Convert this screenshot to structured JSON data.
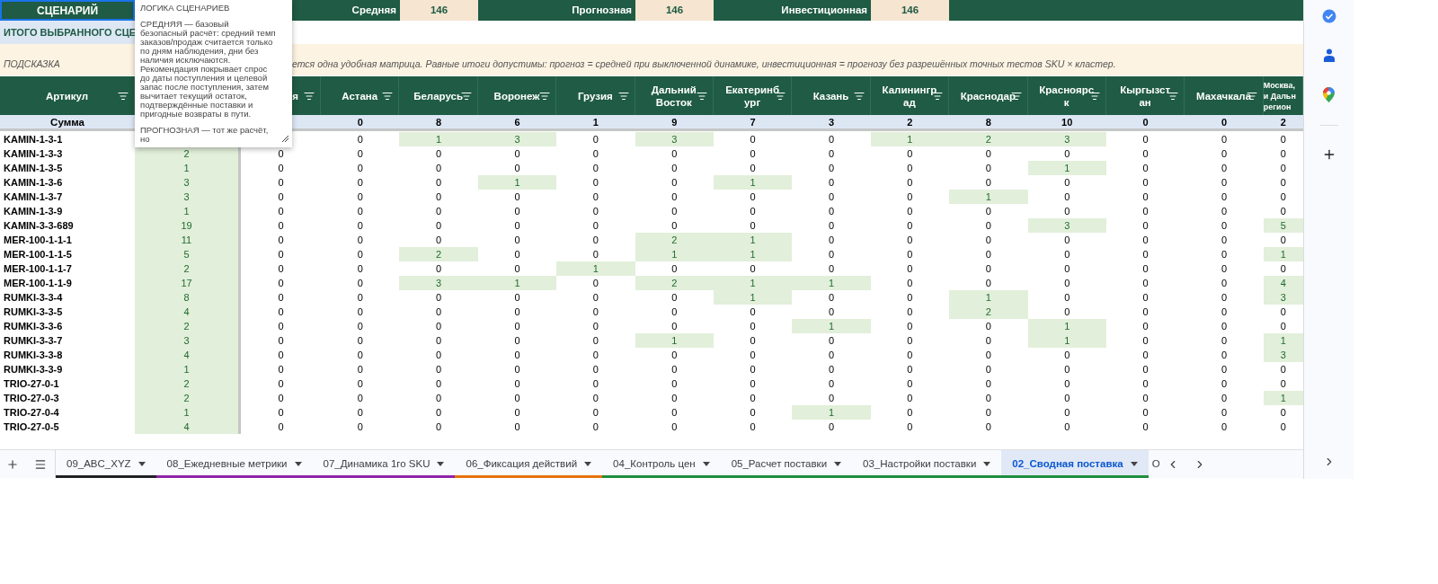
{
  "top_bar": {
    "title": "СЦЕНАРИЙ",
    "scenarios": [
      {
        "label": "Средняя",
        "value": "146"
      },
      {
        "label": "Прогнозная",
        "value": "146"
      },
      {
        "label": "Инвестиционная",
        "value": "146"
      }
    ]
  },
  "summary_label": "ИТОГО ВЫБРАННОГО СЦЕ",
  "hint": {
    "label": "ПОДСКАЗКА",
    "text": "ется одна удобная матрица. Равные итоги допустимы: прогноз = средней при выключенной динамике, инвестиционная = прогнозу без разрешённых точных тестов SKU × кластер."
  },
  "tooltip": {
    "title": "ЛОГИКА СЦЕНАРИЕВ",
    "paragraphs": [
      "СРЕДНЯЯ — базовый безопасный расчёт: средний темп заказов/продаж считается только по дням наблюдения, дни без наличия исключаются. Рекомендация покрывает спрос до даты поступления и целевой запас после поступления, затем вычитает текущий остаток, подтверждённые поставки и пригодные возвраты в пути.",
      "ПРОГНОЗНАЯ — тот же расчёт, но"
    ]
  },
  "table": {
    "sku_header": "Артикул",
    "columns": [
      {
        "label": "я",
        "filter": true
      },
      {
        "label": "Астана",
        "filter": true
      },
      {
        "label": "Беларусь",
        "filter": true
      },
      {
        "label": "Воронеж",
        "filter": true
      },
      {
        "label": "Грузия",
        "filter": true
      },
      {
        "label": "Дальний Восток",
        "filter": true
      },
      {
        "label": "Екатеринбург",
        "filter": true
      },
      {
        "label": "Казань",
        "filter": true
      },
      {
        "label": "Калининград",
        "filter": true
      },
      {
        "label": "Краснодар",
        "filter": true
      },
      {
        "label": "Красноярск",
        "filter": true
      },
      {
        "label": "Кыргызстан",
        "filter": true
      },
      {
        "label": "Махачкала",
        "filter": true
      },
      {
        "label": "Москва,\nи Дальн\nрегион",
        "filter": false
      }
    ],
    "sum_row": {
      "label": "Сумма",
      "values": [
        "0",
        "8",
        "6",
        "1",
        "9",
        "7",
        "3",
        "2",
        "8",
        "10",
        "0",
        "0",
        "2"
      ]
    },
    "rows": [
      {
        "sku": "KAMIN-1-3-1",
        "cells": [
          {},
          {
            "value": "0",
            "highlighted": false
          },
          {
            "value": "1",
            "highlighted": true
          },
          {
            "value": "3",
            "highlighted": true
          },
          {
            "value": "0",
            "highlighted": false
          },
          {
            "value": "3",
            "highlighted": true
          },
          {
            "value": "0",
            "highlighted": false
          },
          {
            "value": "0",
            "highlighted": false
          },
          {
            "value": "1",
            "highlighted": true
          },
          {
            "value": "2",
            "highlighted": true
          },
          {
            "value": "3",
            "highlighted": true
          },
          {
            "value": "0",
            "highlighted": false
          },
          {
            "value": "0",
            "highlighted": false
          },
          {
            "value": "0",
            "highlighted": false
          }
        ]
      },
      {
        "sku": "KAMIN-1-3-3",
        "total": "2",
        "cells": [
          {
            "value": "0",
            "highlighted": false
          },
          {
            "value": "0",
            "highlighted": false
          },
          {
            "value": "0",
            "highlighted": false
          },
          {
            "value": "0",
            "highlighted": false
          },
          {
            "value": "0",
            "highlighted": false
          },
          {
            "value": "0",
            "highlighted": false
          },
          {
            "value": "0",
            "highlighted": false
          },
          {
            "value": "0",
            "highlighted": false
          },
          {
            "value": "0",
            "highlighted": false
          },
          {
            "value": "0",
            "highlighted": false
          },
          {
            "value": "0",
            "highlighted": false
          },
          {
            "value": "0",
            "highlighted": false
          },
          {
            "value": "0",
            "highlighted": false
          },
          {
            "value": "0",
            "highlighted": false
          }
        ]
      },
      {
        "sku": "KAMIN-1-3-5",
        "total": "1",
        "cells": [
          {
            "value": "0",
            "highlighted": false
          },
          {
            "value": "0",
            "highlighted": false
          },
          {
            "value": "0",
            "highlighted": false
          },
          {
            "value": "0",
            "highlighted": false
          },
          {
            "value": "0",
            "highlighted": false
          },
          {
            "value": "0",
            "highlighted": false
          },
          {
            "value": "0",
            "highlighted": false
          },
          {
            "value": "0",
            "highlighted": false
          },
          {
            "value": "0",
            "highlighted": false
          },
          {
            "value": "0",
            "highlighted": false
          },
          {
            "value": "1",
            "highlighted": true
          },
          {
            "value": "0",
            "highlighted": false
          },
          {
            "value": "0",
            "highlighted": false
          },
          {
            "value": "0",
            "highlighted": false
          }
        ]
      },
      {
        "sku": "KAMIN-1-3-6",
        "total": "3",
        "cells": [
          {
            "value": "0",
            "highlighted": false
          },
          {
            "value": "0",
            "highlighted": false
          },
          {
            "value": "0",
            "highlighted": false
          },
          {
            "value": "1",
            "highlighted": true
          },
          {
            "value": "0",
            "highlighted": false
          },
          {
            "value": "0",
            "highlighted": false
          },
          {
            "value": "1",
            "highlighted": true
          },
          {
            "value": "0",
            "highlighted": false
          },
          {
            "value": "0",
            "highlighted": false
          },
          {
            "value": "0",
            "highlighted": false
          },
          {
            "value": "0",
            "highlighted": false
          },
          {
            "value": "0",
            "highlighted": false
          },
          {
            "value": "0",
            "highlighted": false
          },
          {
            "value": "0",
            "highlighted": false
          }
        ]
      },
      {
        "sku": "KAMIN-1-3-7",
        "total": "3",
        "cells": [
          {
            "value": "0",
            "highlighted": false
          },
          {
            "value": "0",
            "highlighted": false
          },
          {
            "value": "0",
            "highlighted": false
          },
          {
            "value": "0",
            "highlighted": false
          },
          {
            "value": "0",
            "highlighted": false
          },
          {
            "value": "0",
            "highlighted": false
          },
          {
            "value": "0",
            "highlighted": false
          },
          {
            "value": "0",
            "highlighted": false
          },
          {
            "value": "0",
            "highlighted": false
          },
          {
            "value": "1",
            "highlighted": true
          },
          {
            "value": "0",
            "highlighted": false
          },
          {
            "value": "0",
            "highlighted": false
          },
          {
            "value": "0",
            "highlighted": false
          },
          {
            "value": "0",
            "highlighted": false
          }
        ]
      },
      {
        "sku": "KAMIN-1-3-9",
        "total": "1",
        "cells": [
          {
            "value": "0",
            "highlighted": false
          },
          {
            "value": "0",
            "highlighted": false
          },
          {
            "value": "0",
            "highlighted": false
          },
          {
            "value": "0",
            "highlighted": false
          },
          {
            "value": "0",
            "highlighted": false
          },
          {
            "value": "0",
            "highlighted": false
          },
          {
            "value": "0",
            "highlighted": false
          },
          {
            "value": "0",
            "highlighted": false
          },
          {
            "value": "0",
            "highlighted": false
          },
          {
            "value": "0",
            "highlighted": false
          },
          {
            "value": "0",
            "highlighted": false
          },
          {
            "value": "0",
            "highlighted": false
          },
          {
            "value": "0",
            "highlighted": false
          },
          {
            "value": "0",
            "highlighted": false
          }
        ]
      },
      {
        "sku": "KAMIN-3-3-689",
        "total": "19",
        "cells": [
          {
            "value": "0",
            "highlighted": false
          },
          {
            "value": "0",
            "highlighted": false
          },
          {
            "value": "0",
            "highlighted": false
          },
          {
            "value": "0",
            "highlighted": false
          },
          {
            "value": "0",
            "highlighted": false
          },
          {
            "value": "0",
            "highlighted": false
          },
          {
            "value": "0",
            "highlighted": false
          },
          {
            "value": "0",
            "highlighted": false
          },
          {
            "value": "0",
            "highlighted": false
          },
          {
            "value": "0",
            "highlighted": false
          },
          {
            "value": "3",
            "highlighted": true
          },
          {
            "value": "0",
            "highlighted": false
          },
          {
            "value": "0",
            "highlighted": false
          },
          {
            "value": "5",
            "highlighted": true
          }
        ]
      },
      {
        "sku": "MER-100-1-1-1",
        "total": "11",
        "cells": [
          {
            "value": "0",
            "highlighted": false
          },
          {
            "value": "0",
            "highlighted": false
          },
          {
            "value": "0",
            "highlighted": false
          },
          {
            "value": "0",
            "highlighted": false
          },
          {
            "value": "0",
            "highlighted": false
          },
          {
            "value": "2",
            "highlighted": true
          },
          {
            "value": "1",
            "highlighted": true
          },
          {
            "value": "0",
            "highlighted": false
          },
          {
            "value": "0",
            "highlighted": false
          },
          {
            "value": "0",
            "highlighted": false
          },
          {
            "value": "0",
            "highlighted": false
          },
          {
            "value": "0",
            "highlighted": false
          },
          {
            "value": "0",
            "highlighted": false
          },
          {
            "value": "0",
            "highlighted": false
          }
        ]
      },
      {
        "sku": "MER-100-1-1-5",
        "total": "5",
        "cells": [
          {
            "value": "0",
            "highlighted": false
          },
          {
            "value": "0",
            "highlighted": false
          },
          {
            "value": "2",
            "highlighted": true
          },
          {
            "value": "0",
            "highlighted": false
          },
          {
            "value": "0",
            "highlighted": false
          },
          {
            "value": "1",
            "highlighted": true
          },
          {
            "value": "1",
            "highlighted": true
          },
          {
            "value": "0",
            "highlighted": false
          },
          {
            "value": "0",
            "highlighted": false
          },
          {
            "value": "0",
            "highlighted": false
          },
          {
            "value": "0",
            "highlighted": false
          },
          {
            "value": "0",
            "highlighted": false
          },
          {
            "value": "0",
            "highlighted": false
          },
          {
            "value": "1",
            "highlighted": true
          }
        ]
      },
      {
        "sku": "MER-100-1-1-7",
        "total": "2",
        "cells": [
          {
            "value": "0",
            "highlighted": false
          },
          {
            "value": "0",
            "highlighted": false
          },
          {
            "value": "0",
            "highlighted": false
          },
          {
            "value": "0",
            "highlighted": false
          },
          {
            "value": "1",
            "highlighted": true
          },
          {
            "value": "0",
            "highlighted": false
          },
          {
            "value": "0",
            "highlighted": false
          },
          {
            "value": "0",
            "highlighted": false
          },
          {
            "value": "0",
            "highlighted": false
          },
          {
            "value": "0",
            "highlighted": false
          },
          {
            "value": "0",
            "highlighted": false
          },
          {
            "value": "0",
            "highlighted": false
          },
          {
            "value": "0",
            "highlighted": false
          },
          {
            "value": "0",
            "highlighted": false
          }
        ]
      },
      {
        "sku": "MER-100-1-1-9",
        "total": "17",
        "cells": [
          {
            "value": "0",
            "highlighted": false
          },
          {
            "value": "0",
            "highlighted": false
          },
          {
            "value": "3",
            "highlighted": true
          },
          {
            "value": "1",
            "highlighted": true
          },
          {
            "value": "0",
            "highlighted": false
          },
          {
            "value": "2",
            "highlighted": true
          },
          {
            "value": "1",
            "highlighted": true
          },
          {
            "value": "1",
            "highlighted": true
          },
          {
            "value": "0",
            "highlighted": false
          },
          {
            "value": "0",
            "highlighted": false
          },
          {
            "value": "0",
            "highlighted": false
          },
          {
            "value": "0",
            "highlighted": false
          },
          {
            "value": "0",
            "highlighted": false
          },
          {
            "value": "4",
            "highlighted": true
          }
        ]
      },
      {
        "sku": "RUMKI-3-3-4",
        "total": "8",
        "cells": [
          {
            "value": "0",
            "highlighted": false
          },
          {
            "value": "0",
            "highlighted": false
          },
          {
            "value": "0",
            "highlighted": false
          },
          {
            "value": "0",
            "highlighted": false
          },
          {
            "value": "0",
            "highlighted": false
          },
          {
            "value": "0",
            "highlighted": false
          },
          {
            "value": "1",
            "highlighted": true
          },
          {
            "value": "0",
            "highlighted": false
          },
          {
            "value": "0",
            "highlighted": false
          },
          {
            "value": "1",
            "highlighted": true
          },
          {
            "value": "0",
            "highlighted": false
          },
          {
            "value": "0",
            "highlighted": false
          },
          {
            "value": "0",
            "highlighted": false
          },
          {
            "value": "3",
            "highlighted": true
          }
        ]
      },
      {
        "sku": "RUMKI-3-3-5",
        "total": "4",
        "cells": [
          {
            "value": "0",
            "highlighted": false
          },
          {
            "value": "0",
            "highlighted": false
          },
          {
            "value": "0",
            "highlighted": false
          },
          {
            "value": "0",
            "highlighted": false
          },
          {
            "value": "0",
            "highlighted": false
          },
          {
            "value": "0",
            "highlighted": false
          },
          {
            "value": "0",
            "highlighted": false
          },
          {
            "value": "0",
            "highlighted": false
          },
          {
            "value": "0",
            "highlighted": false
          },
          {
            "value": "2",
            "highlighted": true
          },
          {
            "value": "0",
            "highlighted": false
          },
          {
            "value": "0",
            "highlighted": false
          },
          {
            "value": "0",
            "highlighted": false
          },
          {
            "value": "0",
            "highlighted": false
          }
        ]
      },
      {
        "sku": "RUMKI-3-3-6",
        "total": "2",
        "cells": [
          {
            "value": "0",
            "highlighted": false
          },
          {
            "value": "0",
            "highlighted": false
          },
          {
            "value": "0",
            "highlighted": false
          },
          {
            "value": "0",
            "highlighted": false
          },
          {
            "value": "0",
            "highlighted": false
          },
          {
            "value": "0",
            "highlighted": false
          },
          {
            "value": "0",
            "highlighted": false
          },
          {
            "value": "1",
            "highlighted": true
          },
          {
            "value": "0",
            "highlighted": false
          },
          {
            "value": "0",
            "highlighted": false
          },
          {
            "value": "1",
            "highlighted": true
          },
          {
            "value": "0",
            "highlighted": false
          },
          {
            "value": "0",
            "highlighted": false
          },
          {
            "value": "0",
            "highlighted": false
          }
        ]
      },
      {
        "sku": "RUMKI-3-3-7",
        "total": "3",
        "cells": [
          {
            "value": "0",
            "highlighted": false
          },
          {
            "value": "0",
            "highlighted": false
          },
          {
            "value": "0",
            "highlighted": false
          },
          {
            "value": "0",
            "highlighted": false
          },
          {
            "value": "0",
            "highlighted": false
          },
          {
            "value": "1",
            "highlighted": true
          },
          {
            "value": "0",
            "highlighted": false
          },
          {
            "value": "0",
            "highlighted": false
          },
          {
            "value": "0",
            "highlighted": false
          },
          {
            "value": "0",
            "highlighted": false
          },
          {
            "value": "1",
            "highlighted": true
          },
          {
            "value": "0",
            "highlighted": false
          },
          {
            "value": "0",
            "highlighted": false
          },
          {
            "value": "1",
            "highlighted": true
          }
        ]
      },
      {
        "sku": "RUMKI-3-3-8",
        "total": "4",
        "cells": [
          {
            "value": "0",
            "highlighted": false
          },
          {
            "value": "0",
            "highlighted": false
          },
          {
            "value": "0",
            "highlighted": false
          },
          {
            "value": "0",
            "highlighted": false
          },
          {
            "value": "0",
            "highlighted": false
          },
          {
            "value": "0",
            "highlighted": false
          },
          {
            "value": "0",
            "highlighted": false
          },
          {
            "value": "0",
            "highlighted": false
          },
          {
            "value": "0",
            "highlighted": false
          },
          {
            "value": "0",
            "highlighted": false
          },
          {
            "value": "0",
            "highlighted": false
          },
          {
            "value": "0",
            "highlighted": false
          },
          {
            "value": "0",
            "highlighted": false
          },
          {
            "value": "3",
            "highlighted": true
          }
        ]
      },
      {
        "sku": "RUMKI-3-3-9",
        "total": "1",
        "cells": [
          {
            "value": "0",
            "highlighted": false
          },
          {
            "value": "0",
            "highlighted": false
          },
          {
            "value": "0",
            "highlighted": false
          },
          {
            "value": "0",
            "highlighted": false
          },
          {
            "value": "0",
            "highlighted": false
          },
          {
            "value": "0",
            "highlighted": false
          },
          {
            "value": "0",
            "highlighted": false
          },
          {
            "value": "0",
            "highlighted": false
          },
          {
            "value": "0",
            "highlighted": false
          },
          {
            "value": "0",
            "highlighted": false
          },
          {
            "value": "0",
            "highlighted": false
          },
          {
            "value": "0",
            "highlighted": false
          },
          {
            "value": "0",
            "highlighted": false
          },
          {
            "value": "0",
            "highlighted": false
          }
        ]
      },
      {
        "sku": "TRIO-27-0-1",
        "total": "2",
        "cells": [
          {
            "value": "0",
            "highlighted": false
          },
          {
            "value": "0",
            "highlighted": false
          },
          {
            "value": "0",
            "highlighted": false
          },
          {
            "value": "0",
            "highlighted": false
          },
          {
            "value": "0",
            "highlighted": false
          },
          {
            "value": "0",
            "highlighted": false
          },
          {
            "value": "0",
            "highlighted": false
          },
          {
            "value": "0",
            "highlighted": false
          },
          {
            "value": "0",
            "highlighted": false
          },
          {
            "value": "0",
            "highlighted": false
          },
          {
            "value": "0",
            "highlighted": false
          },
          {
            "value": "0",
            "highlighted": false
          },
          {
            "value": "0",
            "highlighted": false
          },
          {
            "value": "0",
            "highlighted": false
          }
        ]
      },
      {
        "sku": "TRIO-27-0-3",
        "total": "2",
        "cells": [
          {
            "value": "0",
            "highlighted": false
          },
          {
            "value": "0",
            "highlighted": false
          },
          {
            "value": "0",
            "highlighted": false
          },
          {
            "value": "0",
            "highlighted": false
          },
          {
            "value": "0",
            "highlighted": false
          },
          {
            "value": "0",
            "highlighted": false
          },
          {
            "value": "0",
            "highlighted": false
          },
          {
            "value": "0",
            "highlighted": false
          },
          {
            "value": "0",
            "highlighted": false
          },
          {
            "value": "0",
            "highlighted": false
          },
          {
            "value": "0",
            "highlighted": false
          },
          {
            "value": "0",
            "highlighted": false
          },
          {
            "value": "0",
            "highlighted": false
          },
          {
            "value": "1",
            "highlighted": true
          }
        ]
      },
      {
        "sku": "TRIO-27-0-4",
        "total": "1",
        "cells": [
          {
            "value": "0",
            "highlighted": false
          },
          {
            "value": "0",
            "highlighted": false
          },
          {
            "value": "0",
            "highlighted": false
          },
          {
            "value": "0",
            "highlighted": false
          },
          {
            "value": "0",
            "highlighted": false
          },
          {
            "value": "0",
            "highlighted": false
          },
          {
            "value": "0",
            "highlighted": false
          },
          {
            "value": "1",
            "highlighted": true
          },
          {
            "value": "0",
            "highlighted": false
          },
          {
            "value": "0",
            "highlighted": false
          },
          {
            "value": "0",
            "highlighted": false
          },
          {
            "value": "0",
            "highlighted": false
          },
          {
            "value": "0",
            "highlighted": false
          },
          {
            "value": "0",
            "highlighted": false
          }
        ]
      },
      {
        "sku": "TRIO-27-0-5",
        "total": "4",
        "cells": [
          {
            "value": "0",
            "highlighted": false
          },
          {
            "value": "0",
            "highlighted": false
          },
          {
            "value": "0",
            "highlighted": false
          },
          {
            "value": "0",
            "highlighted": false
          },
          {
            "value": "0",
            "highlighted": false
          },
          {
            "value": "0",
            "highlighted": false
          },
          {
            "value": "0",
            "highlighted": false
          },
          {
            "value": "0",
            "highlighted": false
          },
          {
            "value": "0",
            "highlighted": false
          },
          {
            "value": "0",
            "highlighted": false
          },
          {
            "value": "0",
            "highlighted": false
          },
          {
            "value": "0",
            "highlighted": false
          },
          {
            "value": "0",
            "highlighted": false
          },
          {
            "value": "0",
            "highlighted": false
          }
        ]
      }
    ]
  },
  "tabs": [
    {
      "label": "09_ABC_XYZ",
      "color": "#202124",
      "selected": false
    },
    {
      "label": "08_Ежедневные метрики",
      "color": "#8e24aa",
      "selected": false
    },
    {
      "label": "07_Динамика 1го SKU",
      "color": "#8e24aa",
      "selected": false
    },
    {
      "label": "06_Фиксация действий",
      "color": "#e8710a",
      "selected": false
    },
    {
      "label": "04_Контроль цен",
      "color": "#1e8e3e",
      "selected": false
    },
    {
      "label": "05_Расчет поставки",
      "color": "#1e8e3e",
      "selected": false
    },
    {
      "label": "03_Настройки поставки",
      "color": "#1e8e3e",
      "selected": false
    },
    {
      "label": "02_Сводная поставка",
      "color": "#1e8e3e",
      "selected": true
    }
  ],
  "cut_tab": "О"
}
